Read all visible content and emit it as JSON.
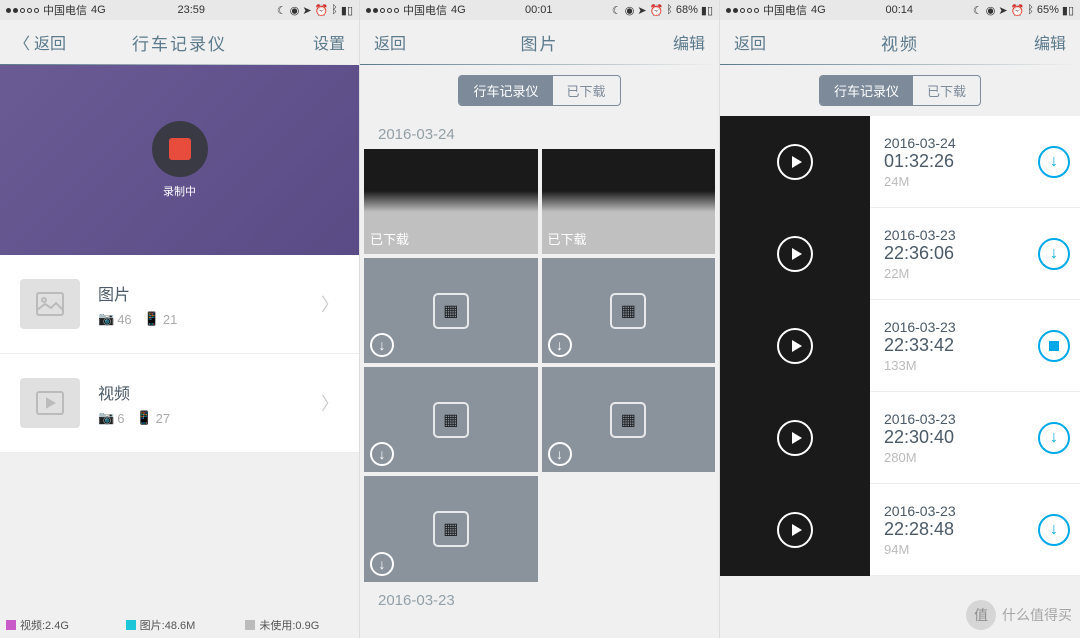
{
  "screen1": {
    "status": {
      "carrier": "中国电信",
      "network": "4G",
      "time": "23:59",
      "battery": ""
    },
    "nav": {
      "back": "返回",
      "title": "行车记录仪",
      "right": "设置"
    },
    "recording": {
      "label": "录制中"
    },
    "menu": {
      "photo": {
        "title": "图片",
        "count1": "46",
        "count2": "21"
      },
      "video": {
        "title": "视频",
        "count1": "6",
        "count2": "27"
      }
    },
    "storage": {
      "video": {
        "label": "视频:2.4G",
        "color": "#c95bc9"
      },
      "photo": {
        "label": "图片:48.6M",
        "color": "#1dc5d8"
      },
      "free": {
        "label": "未使用:0.9G",
        "color": "#bbb"
      }
    }
  },
  "screen2": {
    "status": {
      "carrier": "中国电信",
      "network": "4G",
      "time": "00:01",
      "battery": "68%"
    },
    "nav": {
      "back": "返回",
      "title": "图片",
      "right": "编辑"
    },
    "seg": {
      "a": "行车记录仪",
      "b": "已下载"
    },
    "dates": {
      "d1": "2016-03-24",
      "d2": "2016-03-23"
    },
    "cells": {
      "downloaded": "已下载"
    }
  },
  "screen3": {
    "status": {
      "carrier": "中国电信",
      "network": "4G",
      "time": "00:14",
      "battery": "65%"
    },
    "nav": {
      "back": "返回",
      "title": "视频",
      "right": "编辑"
    },
    "seg": {
      "a": "行车记录仪",
      "b": "已下载"
    },
    "videos": [
      {
        "date": "2016-03-24",
        "time": "01:32:26",
        "size": "24M",
        "state": "dl"
      },
      {
        "date": "2016-03-23",
        "time": "22:36:06",
        "size": "22M",
        "state": "dl"
      },
      {
        "date": "2016-03-23",
        "time": "22:33:42",
        "size": "133M",
        "state": "stop"
      },
      {
        "date": "2016-03-23",
        "time": "22:30:40",
        "size": "280M",
        "state": "dl"
      },
      {
        "date": "2016-03-23",
        "time": "22:28:48",
        "size": "94M",
        "state": "dl"
      }
    ]
  },
  "watermark": {
    "badge": "值",
    "text": "什么值得买"
  }
}
